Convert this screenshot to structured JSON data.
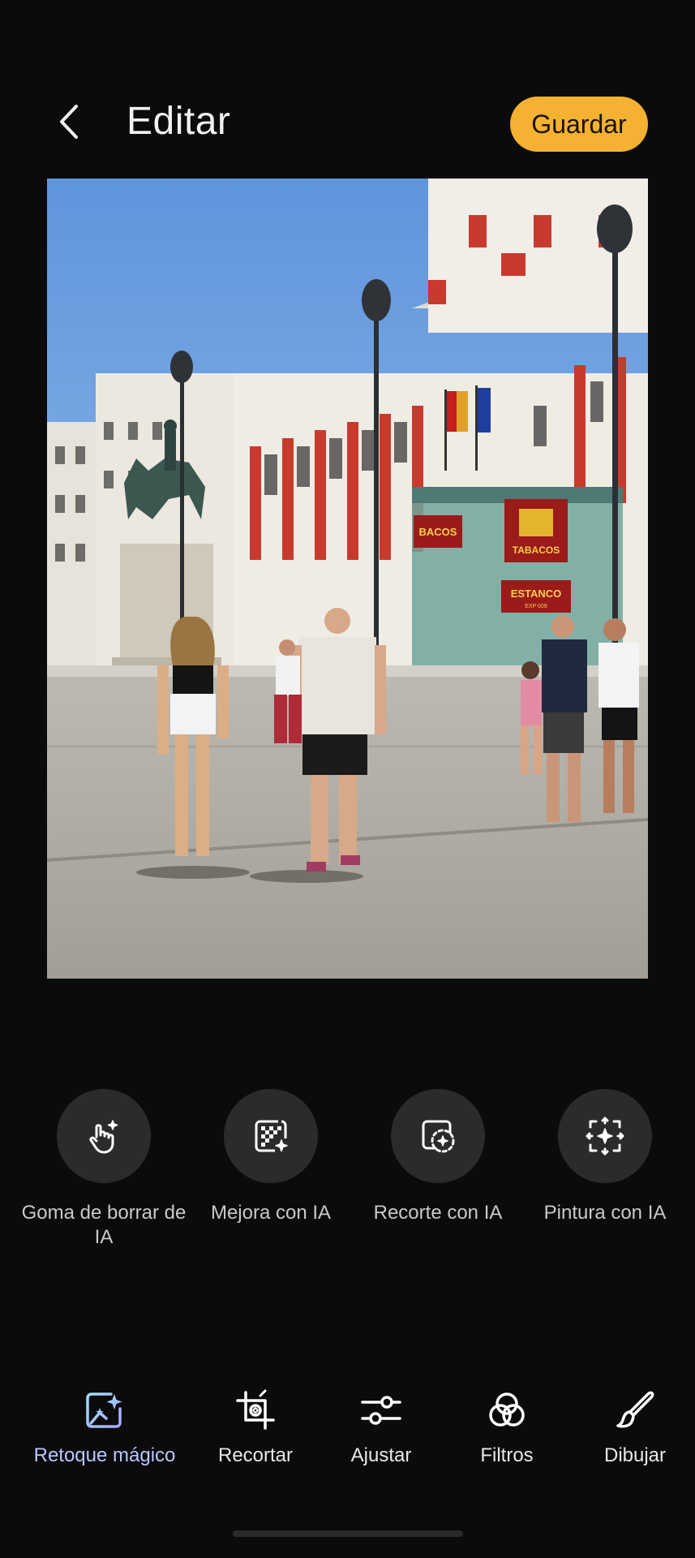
{
  "header": {
    "title": "Editar",
    "save_label": "Guardar"
  },
  "photo": {
    "sign_tabacos": "TABACOS",
    "sign_bacos": "BACOS",
    "sign_estanco": "ESTANCO",
    "sign_expo": "EXP 009"
  },
  "ai_tools": [
    {
      "label": "Goma de borrar de IA",
      "icon": "ai-eraser-icon"
    },
    {
      "label": "Mejora con IA",
      "icon": "ai-enhance-icon"
    },
    {
      "label": "Recorte con IA",
      "icon": "ai-cutout-icon"
    },
    {
      "label": "Pintura con IA",
      "icon": "ai-paint-icon"
    }
  ],
  "bottom_nav": [
    {
      "label": "Retoque mágico",
      "icon": "magic-retouch-icon",
      "active": true
    },
    {
      "label": "Recortar",
      "icon": "crop-icon",
      "active": false
    },
    {
      "label": "Ajustar",
      "icon": "sliders-icon",
      "active": false
    },
    {
      "label": "Filtros",
      "icon": "filters-icon",
      "active": false
    },
    {
      "label": "Dibujar",
      "icon": "brush-icon",
      "active": false
    }
  ],
  "colors": {
    "background": "#0b0b0c",
    "accent_save": "#f5b131",
    "active_nav": "#b8c8ff",
    "tool_circle": "#2b2b2d"
  }
}
